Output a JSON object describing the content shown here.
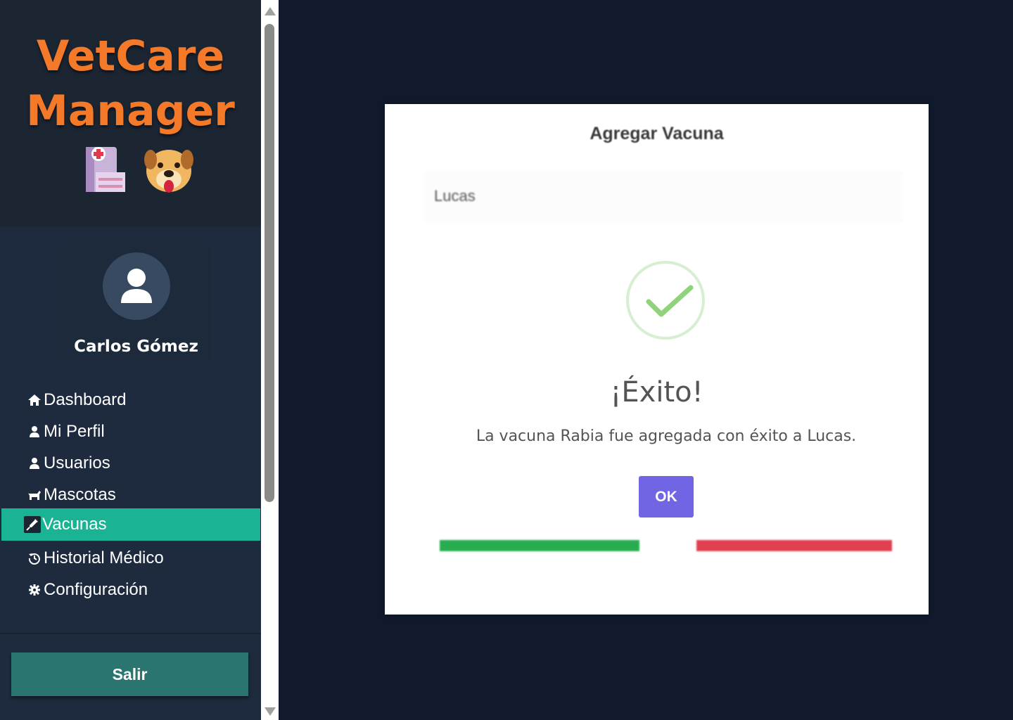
{
  "sidebar": {
    "brand": {
      "line1": "VetCare",
      "line2": "Manager"
    },
    "user": {
      "name": "Carlos Gómez"
    },
    "menu": [
      {
        "label": "Dashboard",
        "icon": "home-icon"
      },
      {
        "label": "Mi Perfil",
        "icon": "user-icon"
      },
      {
        "label": "Usuarios",
        "icon": "user-icon"
      },
      {
        "label": "Mascotas",
        "icon": "dog-icon"
      },
      {
        "label": "Vacunas",
        "icon": "syringe-icon",
        "active": true
      },
      {
        "label": "Historial Médico",
        "icon": "history-icon"
      },
      {
        "label": "Configuración",
        "icon": "gear-icon"
      }
    ],
    "logout_label": "Salir"
  },
  "modal": {
    "title": "Agregar Vacuna",
    "pet_value": "Lucas",
    "alert": {
      "icon": "success-check-icon",
      "title": "¡Éxito!",
      "text": "La vacuna Rabia fue agregada con éxito a Lucas.",
      "confirm_label": "OK"
    }
  },
  "colors": {
    "brand_orange": "#f47a2a",
    "active_menu": "#1ab394",
    "logout_button": "#2b7571",
    "ok_button": "#7265e3",
    "success_green": "#27ad4f",
    "danger_red": "#e04150"
  }
}
